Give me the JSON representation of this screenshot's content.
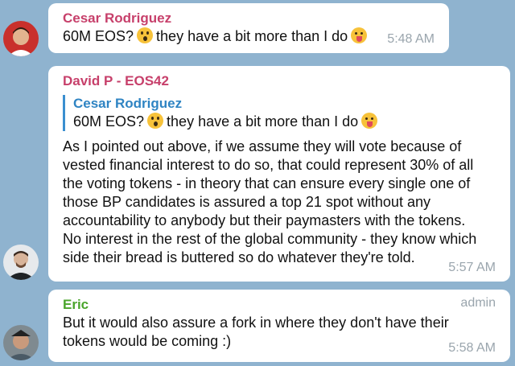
{
  "messages": [
    {
      "author": "Cesar Rodriguez",
      "author_color": "#c7406b",
      "text_before": "60M EOS?",
      "emoji1": "astonished-face-icon",
      "text_middle": "they have a bit more than I do",
      "emoji2": "tongue-face-icon",
      "time": "5:48 AM"
    },
    {
      "author": "David P - EOS42",
      "author_color": "#c7406b",
      "quote": {
        "author": "Cesar Rodriguez",
        "text_before": "60M EOS?",
        "text_middle": "they have a bit more than I do"
      },
      "lines": [
        "As I pointed out above, if we assume they will vote because of",
        "vested financial interest to do so, that could represent 30% of all",
        "the voting tokens - in theory that can ensure every single one of",
        "those BP candidates is assured a top 21 spot without any",
        "accountability to anybody but their paymasters with the tokens.",
        "No interest in the rest of the global community - they know which",
        "side their bread is buttered so do whatever they're told."
      ],
      "time": "5:57 AM"
    },
    {
      "author": "Eric",
      "author_color": "#4aa52b",
      "badge": "admin",
      "lines": [
        "But it would also assure a fork in where they don't have their",
        "tokens would be coming :)"
      ],
      "time": "5:58 AM"
    }
  ]
}
